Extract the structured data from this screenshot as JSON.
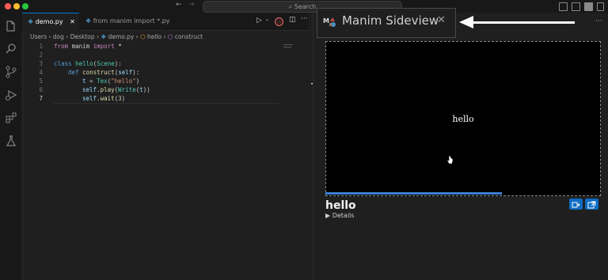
{
  "titlebar": {
    "search_label": "Search"
  },
  "tabs": [
    {
      "label": "demo.py",
      "close": "✕"
    },
    {
      "label": "from manim import *.py"
    }
  ],
  "breadcrumb": [
    "Users",
    "dog",
    "Desktop",
    "demo.py",
    "hello",
    "construct"
  ],
  "code": {
    "line_numbers": [
      "1",
      "2",
      "3",
      "4",
      "5",
      "6",
      "7"
    ],
    "line1": {
      "kw": "from",
      "mod": "manim",
      "kw2": "import",
      "star": "*"
    },
    "line3": {
      "kw": "class",
      "name": "hello",
      "base": "Scene"
    },
    "line4": {
      "kw": "def",
      "name": "construct",
      "arg": "self"
    },
    "line5": {
      "var": "t",
      "fn": "Tex",
      "str": "\"hello\""
    },
    "line6": {
      "obj": "self",
      "fn": "play",
      "fn2": "Write",
      "arg": "t"
    },
    "line7": {
      "obj": "self",
      "fn": "wait",
      "num": "3"
    }
  },
  "sideview": {
    "title": "Manim Sideview",
    "close": "✕",
    "render_text": "hello",
    "scene_name": "hello",
    "details_label": "Details",
    "progress": 0.64
  },
  "colors": {
    "accent": "#0e6cc4",
    "progress": "#3b7fd6"
  }
}
